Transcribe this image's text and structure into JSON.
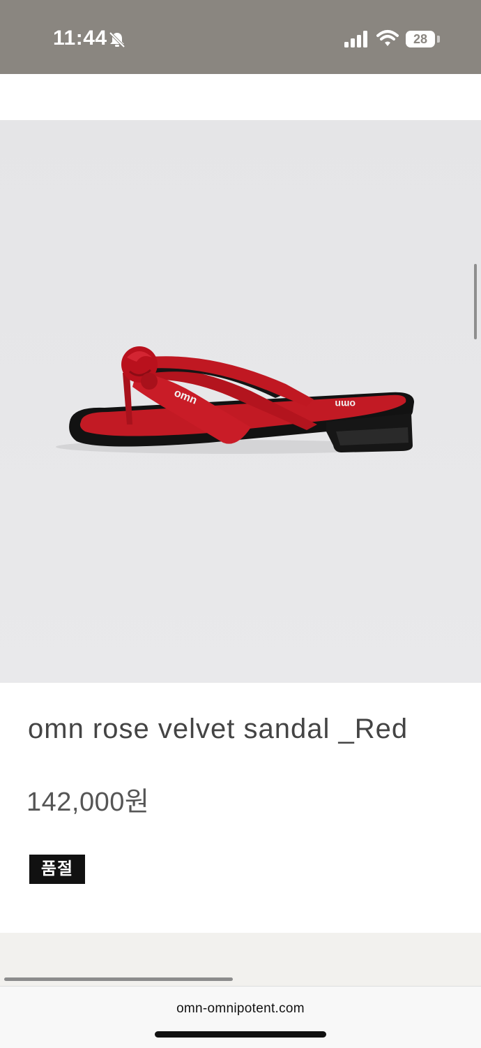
{
  "status_bar": {
    "time": "11:44",
    "battery": "28",
    "icons": [
      "bell-slash-icon",
      "cellular-signal-icon",
      "wifi-icon",
      "battery-icon"
    ]
  },
  "product": {
    "image_label": "omn",
    "image_icon": "sandal-product-photo",
    "title": "omn rose velvet sandal _Red",
    "price": "142,000원",
    "badge": "품절"
  },
  "browser": {
    "url": "omn-omnipotent.com"
  },
  "colors": {
    "status_bar_bg": "#8a8680",
    "image_bg": "#e7e7e9",
    "sandal_red": "#c01822",
    "sandal_sole": "#111111",
    "badge_bg": "#111111",
    "title_text": "#444444"
  }
}
